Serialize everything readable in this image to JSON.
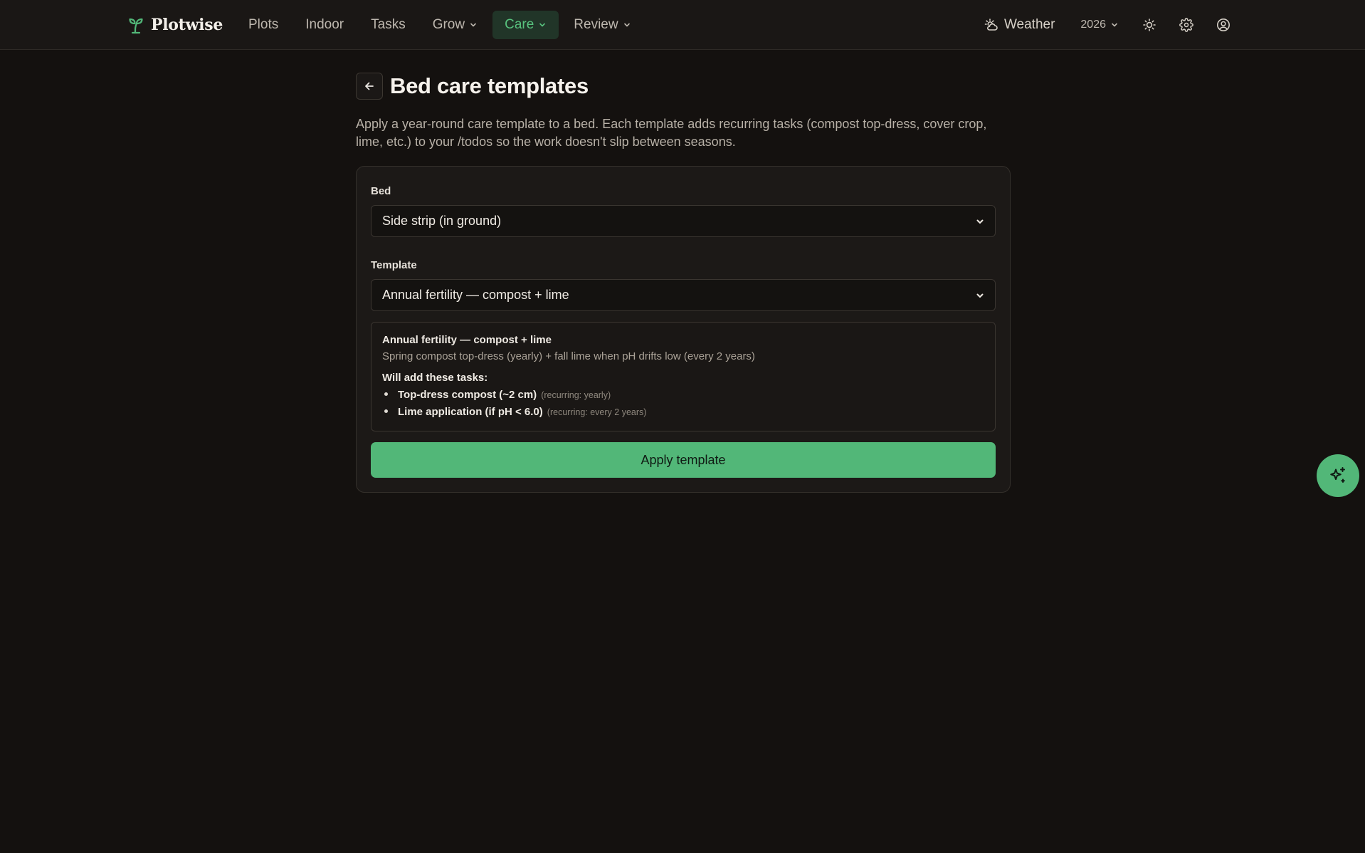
{
  "brand": {
    "name": "Plotwise",
    "icon": "sprout-icon",
    "accent": "#52b778"
  },
  "nav": {
    "items": [
      {
        "label": "Plots",
        "dropdown": false,
        "active": false
      },
      {
        "label": "Indoor",
        "dropdown": false,
        "active": false
      },
      {
        "label": "Tasks",
        "dropdown": false,
        "active": false
      },
      {
        "label": "Grow",
        "dropdown": true,
        "active": false
      },
      {
        "label": "Care",
        "dropdown": true,
        "active": true
      },
      {
        "label": "Review",
        "dropdown": true,
        "active": false
      }
    ],
    "weather_label": "Weather",
    "year": "2026",
    "icons": [
      "sun-icon",
      "gear-icon",
      "user-circle-icon"
    ]
  },
  "page": {
    "title": "Bed care templates",
    "intro": "Apply a year-round care template to a bed. Each template adds recurring tasks (compost top-dress, cover crop, lime, etc.) to your /todos so the work doesn't slip between seasons."
  },
  "form": {
    "bed_label": "Bed",
    "bed_value": "Side strip (in ground)",
    "template_label": "Template",
    "template_value": "Annual fertility — compost + lime",
    "preview": {
      "title": "Annual fertility — compost + lime",
      "description": "Spring compost top-dress (yearly) + fall lime when pH drifts low (every 2 years)",
      "will_add_label": "Will add these tasks:",
      "tasks": [
        {
          "name": "Top-dress compost (~2 cm)",
          "recurrence": "(recurring: yearly)"
        },
        {
          "name": "Lime application (if pH < 6.0)",
          "recurrence": "(recurring: every 2 years)"
        }
      ]
    },
    "apply_label": "Apply template"
  },
  "fab": {
    "icon": "sparkles-icon"
  }
}
